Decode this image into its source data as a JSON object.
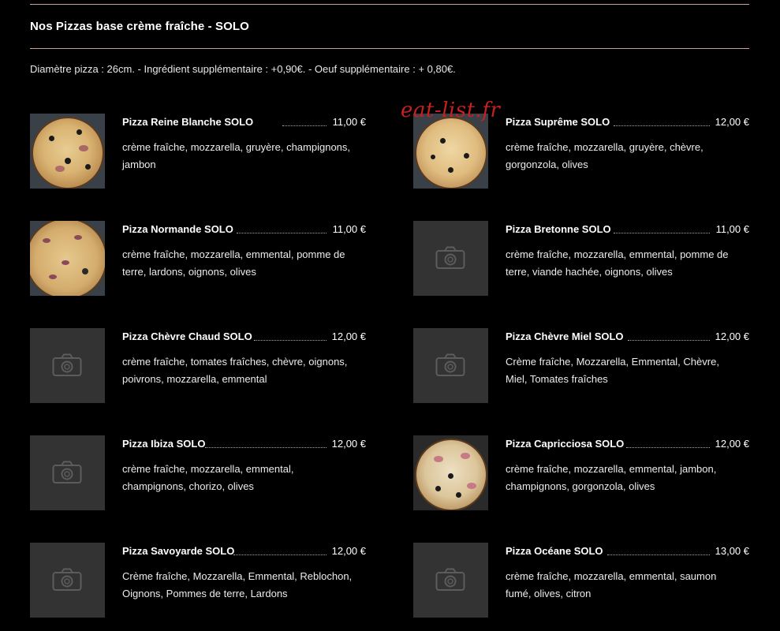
{
  "section": {
    "title": "Nos Pizzas base crème fraîche - SOLO",
    "info": "Diamètre pizza : 26cm. - Ingrédient supplémentaire : +0,90€. - Oeuf supplémentaire : + 0,80€."
  },
  "watermark": "eat-list.fr",
  "items": [
    {
      "name": "Pizza Reine Blanche SOLO",
      "price": "11,00 €",
      "description": "crème fraîche, mozzarella, gruyère, champignons, jambon",
      "image": "photo"
    },
    {
      "name": "Pizza Suprême SOLO",
      "price": "12,00 €",
      "description": "crème fraîche, mozzarella, gruyère, chèvre, gorgonzola, olives",
      "image": "photo"
    },
    {
      "name": "Pizza Normande SOLO",
      "price": "11,00 €",
      "description": "crème fraîche, mozzarella, emmental, pomme de terre, lardons, oignons, olives",
      "image": "photo"
    },
    {
      "name": "Pizza Bretonne SOLO",
      "price": "11,00 €",
      "description": "crème fraîche, mozzarella, emmental, pomme de terre, viande hachée, oignons, olives",
      "image": "placeholder"
    },
    {
      "name": "Pizza Chèvre Chaud SOLO",
      "price": "12,00 €",
      "description": "crème fraîche, tomates fraîches, chèvre, oignons, poivrons, mozzarella, emmental",
      "image": "placeholder"
    },
    {
      "name": "Pizza Chèvre Miel SOLO",
      "price": "12,00 €",
      "description": "Crème fraîche, Mozzarella, Emmental, Chèvre, Miel, Tomates fraîches",
      "image": "placeholder"
    },
    {
      "name": "Pizza Ibiza SOLO",
      "price": "12,00 €",
      "description": "crème fraîche, mozzarella, emmental, champignons, chorizo, olives",
      "image": "placeholder"
    },
    {
      "name": "Pizza Capricciosa SOLO",
      "price": "12,00 €",
      "description": "crème fraîche, mozzarella, emmental, jambon, champignons, gorgonzola, olives",
      "image": "photo"
    },
    {
      "name": "Pizza Savoyarde SOLO",
      "price": "12,00 €",
      "description": "Crème fraîche, Mozzarella, Emmental, Reblochon, Oignons, Pommes de terre, Lardons",
      "image": "placeholder"
    },
    {
      "name": "Pizza Océane SOLO",
      "price": "13,00 €",
      "description": "crème fraîche, mozzarella, emmental, saumon fumé, olives, citron",
      "image": "placeholder"
    }
  ],
  "colors": {
    "background": "#000000",
    "rule": "#c9a39a",
    "placeholder": "#333333",
    "watermark": "#c62020"
  }
}
